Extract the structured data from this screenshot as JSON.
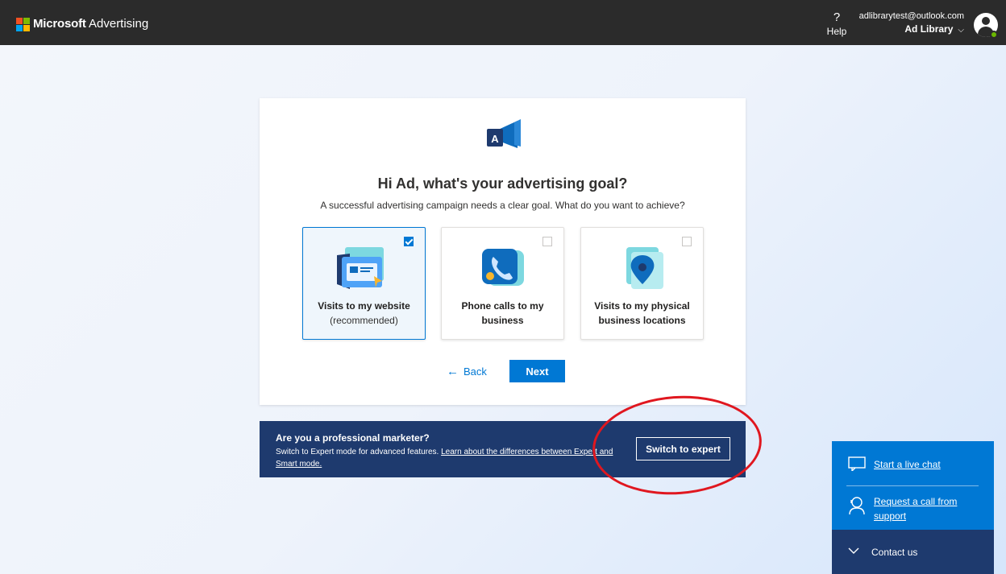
{
  "header": {
    "brand": "Microsoft",
    "product": "Advertising",
    "help_icon": "?",
    "help_label": "Help",
    "account_email": "adlibrarytest@outlook.com",
    "account_name": "Ad Library",
    "account_chevron": "⌵"
  },
  "card": {
    "title": "Hi Ad, what's your advertising goal?",
    "subtitle": "A successful advertising campaign needs a clear goal. What do you want to achieve?",
    "options": [
      {
        "label": "Visits to my website",
        "sub": "(recommended)",
        "selected": true,
        "icon": "website-icon"
      },
      {
        "label": "Phone calls to my business",
        "sub": "",
        "selected": false,
        "icon": "phone-icon"
      },
      {
        "label": "Visits to my physical business locations",
        "sub": "",
        "selected": false,
        "icon": "location-pin-icon"
      }
    ],
    "back_label": "Back",
    "back_arrow": "←",
    "next_label": "Next"
  },
  "banner": {
    "title": "Are you a professional marketer?",
    "desc_prefix": "Switch to Expert mode for advanced features. ",
    "desc_link": "Learn about the differences between Expert and Smart mode.",
    "button_label": "Switch to expert"
  },
  "support": {
    "chat_label": "Start a live chat",
    "call_label": "Request a call from support",
    "contact_label": "Contact us"
  },
  "colors": {
    "accent": "#0078d4",
    "topbar": "#2b2b2b",
    "banner": "#1e3a6e",
    "annotation": "#e0171f"
  }
}
